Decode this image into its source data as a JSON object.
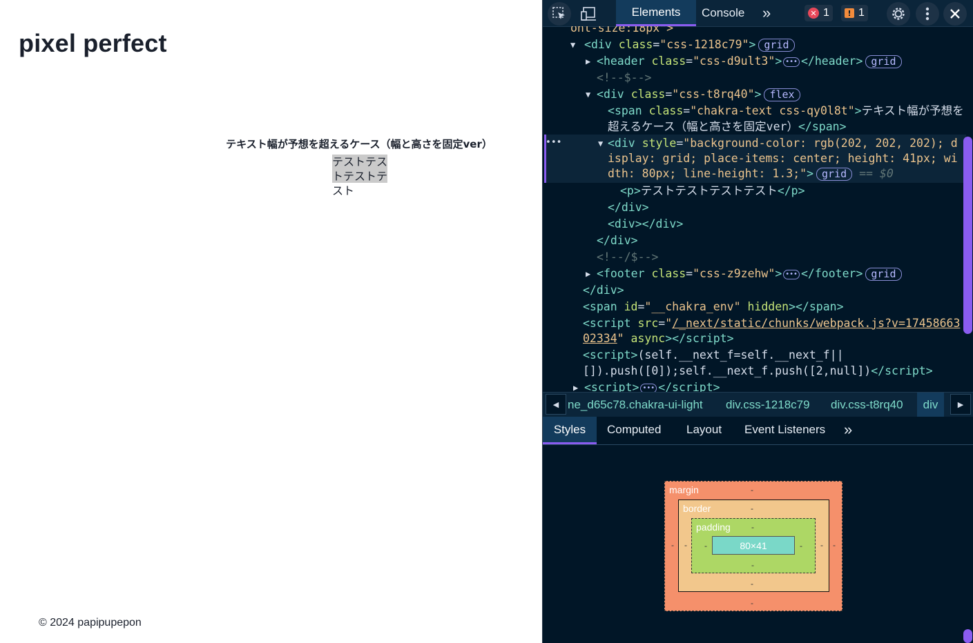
{
  "page": {
    "title": "pixel perfect",
    "demo_heading": "テキスト幅が予想を超えるケース（幅と高さを固定ver）",
    "demo_text": "テストテストテストテスト",
    "footer": "© 2024 papipupepon"
  },
  "devtools": {
    "tabs": [
      "Elements",
      "Console"
    ],
    "more_tabs": "»",
    "error_count": "1",
    "warning_count": "1",
    "dom": {
      "l0": "ont-size:18px\">",
      "l1_tag": "div",
      "l1_attr": "class",
      "l1_val": "css-1218c79",
      "l1_pill": "grid",
      "l2_tag": "header",
      "l2_attr": "class",
      "l2_val": "css-d9ult3",
      "l2_pill": "grid",
      "l3": "<!--$-->",
      "l4_tag": "div",
      "l4_attr": "class",
      "l4_val": "css-t8rq40",
      "l4_pill": "flex",
      "l5_tag": "span",
      "l5_attr": "class",
      "l5_val": "chakra-text css-qy0l8t",
      "l5_text_a": "テキスト幅が予想を",
      "l5_text_b": "超えるケース（幅と高さを固定ver）",
      "l6_attr": "style",
      "l6_val_a": "background-color: rgb(202, 202, 202); d",
      "l6_val_b": "isplay: grid; place-items: center; height: 41px; wi",
      "l6_val_c": "dth: 80px; line-height: 1.3;",
      "l6_pill": "grid",
      "l6_ref": "== $0",
      "l7_text": "テストテストテストテスト",
      "l10": "<!--/$-->",
      "l11_tag": "footer",
      "l11_attr": "class",
      "l11_val": "css-z9zehw",
      "l11_pill": "grid",
      "l13_id": "__chakra_env",
      "l13_hidden": "hidden",
      "l14_src_a": "/_next/static/chunks/webpack.js?v=17458663",
      "l14_src_b": "02334",
      "l14_async": "async",
      "l15_a": "(self.__next_f=self.__next_f||",
      "l15_b": "[]).push([0]);self.__next_f.push([2,null])"
    },
    "breadcrumbs": [
      "ne_d65c78.chakra-ui-light",
      "div.css-1218c79",
      "div.css-t8rq40",
      "div"
    ],
    "subtabs": [
      "Styles",
      "Computed",
      "Layout",
      "Event Listeners"
    ],
    "boxmodel": {
      "margin_label": "margin",
      "border_label": "border",
      "padding_label": "padding",
      "content_size": "80×41",
      "dash": "-"
    }
  }
}
